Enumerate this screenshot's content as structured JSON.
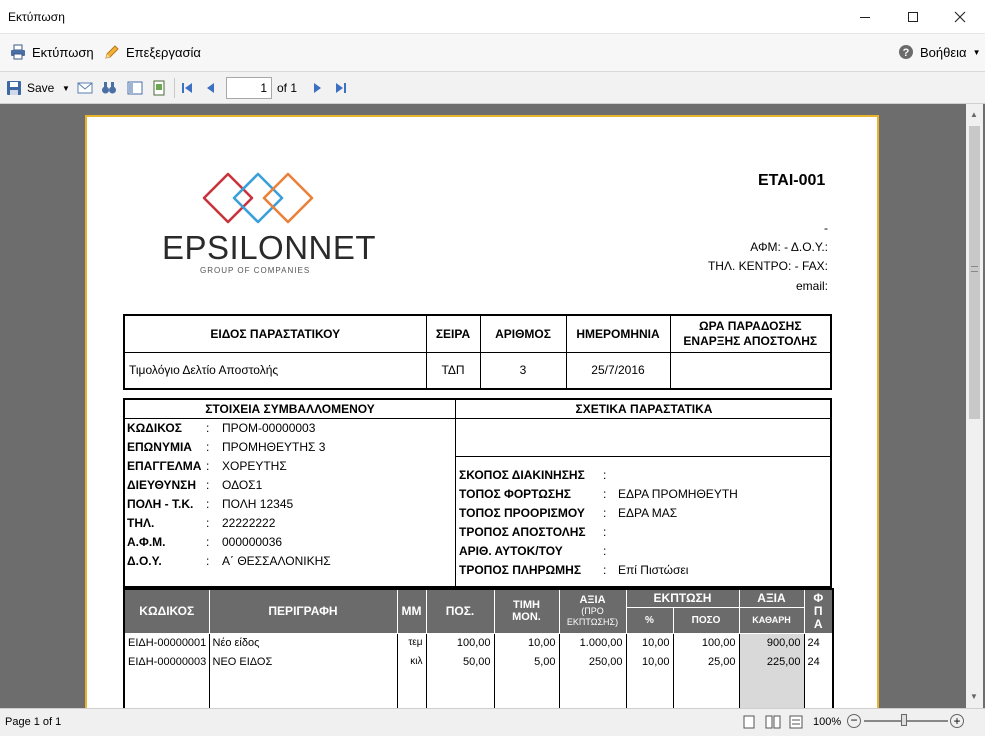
{
  "window": {
    "title": "Εκτύπωση"
  },
  "menu": {
    "print_label": "Εκτύπωση",
    "edit_label": "Επεξεργασία",
    "help_label": "Βοήθεια"
  },
  "toolbar": {
    "save_label": "Save",
    "page_value": "1",
    "page_of": "of 1"
  },
  "status": {
    "page_text": "Page 1 of 1",
    "zoom": "100%"
  },
  "company": {
    "name": "EPSILONNET",
    "tagline": "GROUP OF COMPANIES"
  },
  "doc": {
    "code": "ETAI-001",
    "dash": "-",
    "afm_line": "ΑΦΜ:  - Δ.Ο.Υ.:",
    "phone_line": "ΤΗΛ. ΚΕΝΤΡΟ:  - FAX:",
    "email_line": "email:"
  },
  "header_table": {
    "headers": [
      "ΕΙΔΟΣ ΠΑΡΑΣΤΑΤΙΚΟΥ",
      "ΣΕΙΡΑ",
      "ΑΡΙΘΜΟΣ",
      "ΗΜΕΡΟΜΗΝΙΑ",
      "ΩΡΑ ΠΑΡΑΔΟΣΗΣ",
      "ΕΝΑΡΞΗΣ ΑΠΟΣΤΟΛΗΣ"
    ],
    "row": [
      "Τιμολόγιο Δελτίο Αποστολής",
      "ΤΔΠ",
      "3",
      "25/7/2016",
      ""
    ]
  },
  "party": {
    "title": "ΣΤΟΙΧΕΙΑ ΣΥΜΒΑΛΛΟΜΕΝΟΥ",
    "rows": [
      {
        "label": "ΚΩΔΙΚΟΣ",
        "value": "ΠΡΟΜ-00000003"
      },
      {
        "label": "ΕΠΩΝΥΜΙΑ",
        "value": "ΠΡΟΜΗΘΕΥΤΗΣ 3"
      },
      {
        "label": "ΕΠΑΓΓΕΛΜΑ",
        "value": "ΧΟΡΕΥΤΗΣ"
      },
      {
        "label": "ΔΙΕΥΘΥΝΣΗ",
        "value": "ΟΔΟΣ1"
      },
      {
        "label": "ΠΟΛΗ - Τ.Κ.",
        "value": "ΠΟΛΗ 12345"
      },
      {
        "label": "ΤΗΛ.",
        "value": "22222222"
      },
      {
        "label": "Α.Φ.Μ.",
        "value": "000000036"
      },
      {
        "label": "Δ.Ο.Υ.",
        "value": "Α΄ ΘΕΣΣΑΛΟΝΙΚΗΣ"
      }
    ]
  },
  "related": {
    "title": "ΣΧΕΤΙΚΑ ΠΑΡΑΣΤΑΤΙΚΑ",
    "rows": [
      {
        "label": "ΣΚΟΠΟΣ ΔΙΑΚΙΝΗΣΗΣ",
        "value": ""
      },
      {
        "label": "ΤΟΠΟΣ ΦΟΡΤΩΣΗΣ",
        "value": "ΕΔΡΑ ΠΡΟΜΗΘΕΥΤΗ"
      },
      {
        "label": "ΤΟΠΟΣ ΠΡΟΟΡΙΣΜΟΥ",
        "value": "ΕΔΡΑ ΜΑΣ"
      },
      {
        "label": "ΤΡΟΠΟΣ ΑΠΟΣΤΟΛΗΣ",
        "value": ""
      },
      {
        "label": "ΑΡΙΘ. ΑΥΤΟΚ/ΤΟΥ",
        "value": ""
      },
      {
        "label": "ΤΡΟΠΟΣ ΠΛΗΡΩΜΗΣ",
        "value": "Επί Πιστώσει"
      }
    ]
  },
  "items": {
    "headers": {
      "code": "ΚΩΔΙΚΟΣ",
      "desc": "ΠΕΡΙΓΡΑΦΗ",
      "mm": "ΜΜ",
      "qty": "ΠΟΣ.",
      "price_1": "ΤΙΜΗ",
      "price_2": "ΜΟΝ.",
      "value": "ΑΞΙΑ",
      "value_sub": "(ΠΡΟ ΕΚΠΤΩΣΗΣ)",
      "discount": "ΕΚΠΤΩΣΗ",
      "disc_pct": "%",
      "disc_amt": "ΠΟΣΟ",
      "net": "ΑΞΙΑ",
      "net_sub": "ΚΑΘΑΡΗ",
      "vat_1": "Φ",
      "vat_2": "Π",
      "vat_3": "Α"
    },
    "rows": [
      [
        "ΕΙΔΗ-00000001",
        "Νέο είδος",
        "τεμ",
        "100,00",
        "10,00",
        "1.000,00",
        "10,00",
        "100,00",
        "900,00",
        "24"
      ],
      [
        "ΕΙΔΗ-00000003",
        "ΝΕΟ ΕΙΔΟΣ",
        "κιλ",
        "50,00",
        "5,00",
        "250,00",
        "10,00",
        "25,00",
        "225,00",
        "24"
      ]
    ]
  }
}
